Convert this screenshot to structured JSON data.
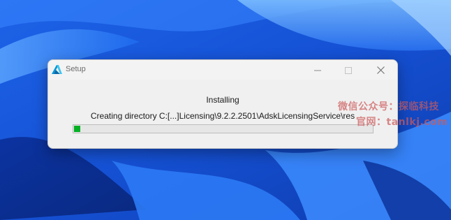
{
  "window": {
    "title": "Setup",
    "icon": "autodesk-logo-icon"
  },
  "controls": {
    "minimize_icon": "minimize-icon",
    "maximize_icon": "maximize-icon",
    "close_icon": "close-icon"
  },
  "installer": {
    "status_title": "Installing",
    "status_detail": "Creating directory C:[...]Licensing\\9.2.2.2501\\AdskLicensingService\\res",
    "progress_fraction": 0.02,
    "progress_color": "#06b025"
  },
  "watermark": {
    "line1": "微信公众号：探临科技",
    "line2": "官网：tanlkj.com"
  },
  "colors": {
    "desktop_blue": "#1a56d8",
    "dialog_bg": "#f0f0f0"
  }
}
